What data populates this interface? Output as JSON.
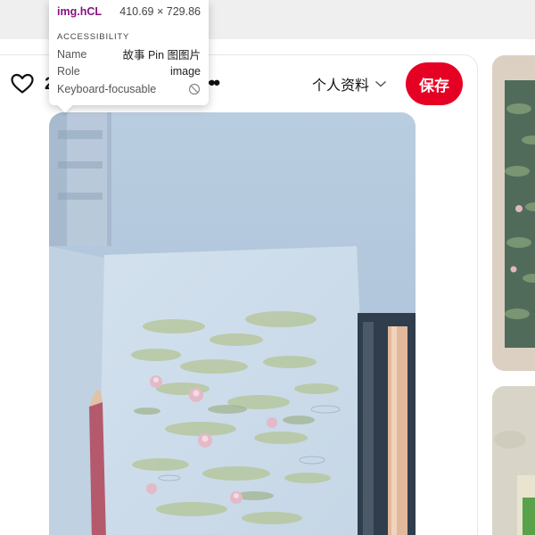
{
  "pin": {
    "like_count": "2",
    "more_label": "•••",
    "profile_label": "个人资料",
    "save_label": "保存"
  },
  "inspector": {
    "tag": "img.hCL",
    "size": "410.69 × 729.86",
    "section": "ACCESSIBILITY",
    "rows": [
      {
        "key": "Name",
        "value": "故事 Pin 图图片"
      },
      {
        "key": "Role",
        "value": "image"
      },
      {
        "key": "Keyboard-focusable",
        "value": ""
      }
    ]
  },
  "colors": {
    "save_button": "#e60023",
    "tag_purple": "#881280"
  }
}
